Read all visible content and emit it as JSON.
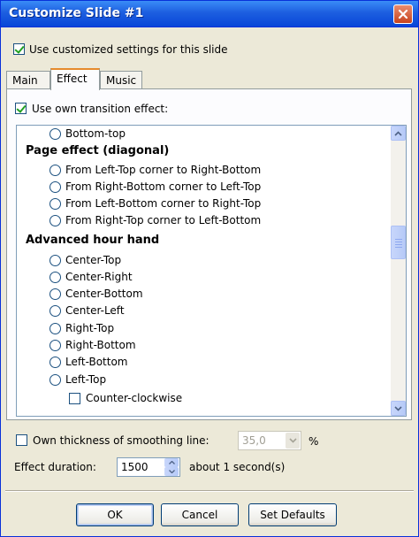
{
  "window": {
    "title": "Customize Slide #1"
  },
  "top_option": {
    "label": "Use customized settings for this slide",
    "checked": true
  },
  "tabs": [
    {
      "label": "Main",
      "active": false
    },
    {
      "label": "Effect",
      "active": true
    },
    {
      "label": "Music",
      "active": false
    }
  ],
  "own_transition": {
    "label": "Use own transition effect:",
    "checked": true
  },
  "effect_list": {
    "rows": [
      {
        "kind": "radio",
        "label": "Bottom-top"
      },
      {
        "kind": "header",
        "label": "Page effect (diagonal)"
      },
      {
        "kind": "radio",
        "label": "From Left-Top corner to Right-Bottom"
      },
      {
        "kind": "radio",
        "label": "From Right-Bottom corner to Left-Top"
      },
      {
        "kind": "radio",
        "label": "From Left-Bottom corner to Right-Top"
      },
      {
        "kind": "radio",
        "label": "From Right-Top corner to Left-Bottom"
      },
      {
        "kind": "header",
        "label": "Advanced hour hand"
      },
      {
        "kind": "radio",
        "label": "Center-Top"
      },
      {
        "kind": "radio",
        "label": "Center-Right"
      },
      {
        "kind": "radio",
        "label": "Center-Bottom"
      },
      {
        "kind": "radio",
        "label": "Center-Left"
      },
      {
        "kind": "radio",
        "label": "Right-Top"
      },
      {
        "kind": "radio",
        "label": "Right-Bottom"
      },
      {
        "kind": "radio",
        "label": "Left-Bottom"
      },
      {
        "kind": "radio",
        "label": "Left-Top"
      },
      {
        "kind": "checkbox",
        "label": "Counter-clockwise"
      }
    ]
  },
  "smoothing": {
    "label": "Own thickness of smoothing line:",
    "checked": false,
    "value": "35,0",
    "unit": "%"
  },
  "duration": {
    "label": "Effect duration:",
    "value": "1500",
    "note": "about 1 second(s)"
  },
  "buttons": {
    "ok": "OK",
    "cancel": "Cancel",
    "defaults": "Set Defaults"
  },
  "colors": {
    "titlebar": "#0846D8",
    "dialog_bg": "#ECE9D8",
    "check_green": "#21A121",
    "tab_highlight": "#E68B2C"
  }
}
